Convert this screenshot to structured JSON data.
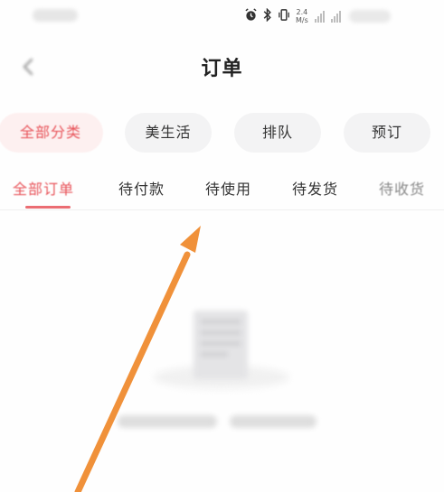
{
  "status_bar": {
    "network_speed_value": "2.4",
    "network_speed_unit": "M/s",
    "icons": [
      "alarm-icon",
      "bluetooth-icon",
      "vibrate-icon",
      "signal-icon"
    ]
  },
  "header": {
    "title": "订单",
    "back_icon": "chevron-left-icon"
  },
  "categories": [
    {
      "label": "全部分类",
      "active": true
    },
    {
      "label": "美生活",
      "active": false
    },
    {
      "label": "排队",
      "active": false
    },
    {
      "label": "预订",
      "active": false
    }
  ],
  "order_tabs": [
    {
      "label": "全部订单",
      "active": true
    },
    {
      "label": "待付款",
      "active": false
    },
    {
      "label": "待使用",
      "active": false
    },
    {
      "label": "待发货",
      "active": false
    },
    {
      "label": "待收货",
      "active": false
    }
  ],
  "empty_state": {
    "icon": "document-icon"
  },
  "colors": {
    "accent": "#e8545a",
    "annotation_arrow": "#f0913a",
    "chip_background": "#f3f3f4"
  }
}
